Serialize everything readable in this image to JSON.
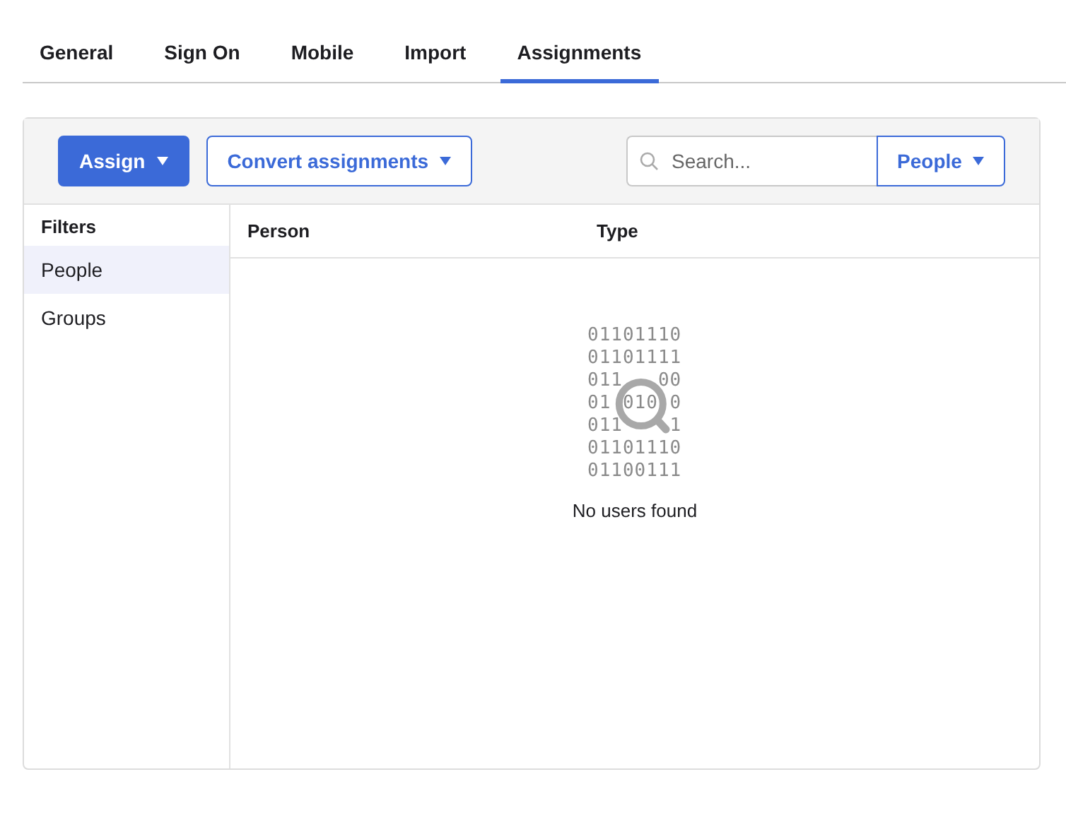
{
  "tabs": [
    {
      "label": "General",
      "selected": false
    },
    {
      "label": "Sign On",
      "selected": false
    },
    {
      "label": "Mobile",
      "selected": false
    },
    {
      "label": "Import",
      "selected": false
    },
    {
      "label": "Assignments",
      "selected": true
    }
  ],
  "toolbar": {
    "assign_button": "Assign",
    "convert_button": "Convert assignments",
    "search": {
      "placeholder": "Search..."
    },
    "scope_dropdown": "People"
  },
  "filters": {
    "title": "Filters",
    "items": [
      {
        "label": "People",
        "selected": true
      },
      {
        "label": "Groups",
        "selected": false
      }
    ]
  },
  "table": {
    "columns": [
      "Person",
      "Type"
    ],
    "empty_state": {
      "binary_lines": [
        "01101110",
        "01101111",
        "011   00",
        "01 010 0",
        "011    1",
        "01101110",
        "01100111"
      ],
      "message": "No users found"
    }
  }
}
